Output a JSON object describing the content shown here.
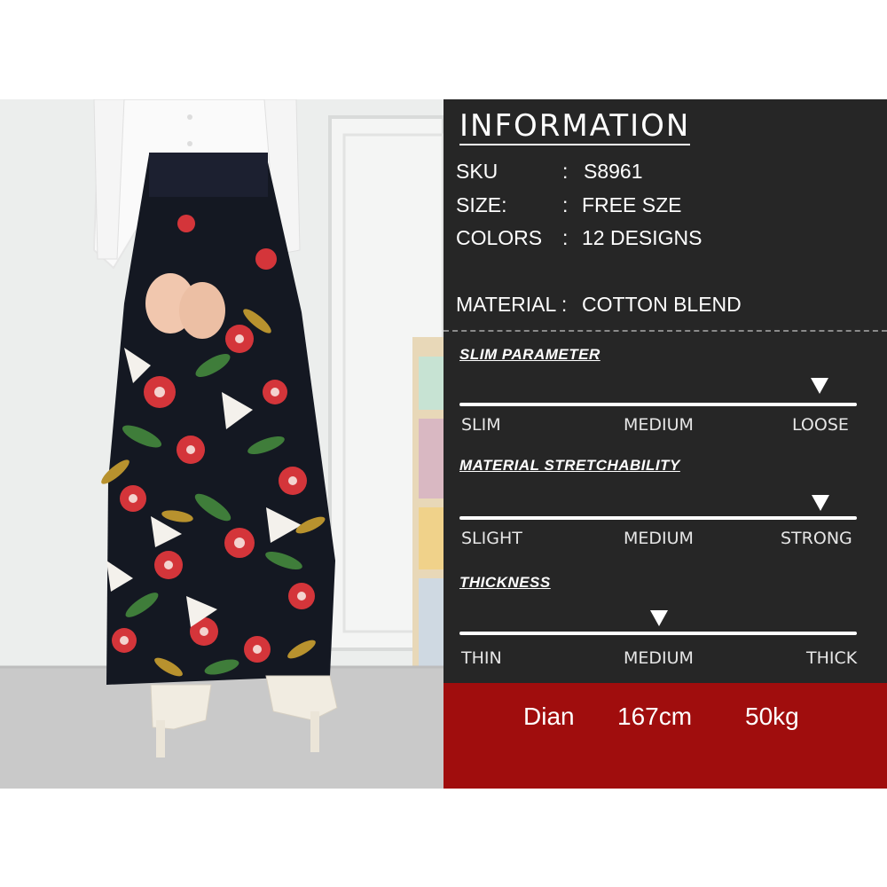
{
  "info": {
    "title": "INFORMATION",
    "rows": [
      {
        "key": "SKU",
        "sep": ":",
        "value": "S8961"
      },
      {
        "key": "SIZE:",
        "sep": ":",
        "value": "FREE SZE"
      },
      {
        "key": "COLORS",
        "sep": ":",
        "value": "12 DESIGNS"
      },
      {
        "key": "MATERIAL :",
        "sep": "",
        "value": "COTTON BLEND"
      }
    ]
  },
  "params": [
    {
      "label": "SLIM PARAMETER",
      "ticks": [
        "SLIM",
        "MEDIUM",
        "LOOSE"
      ],
      "selected": "LOOSE"
    },
    {
      "label": "MATERIAL STRETCHABILITY",
      "ticks": [
        "SLIGHT",
        "MEDIUM",
        "STRONG"
      ],
      "selected": "STRONG"
    },
    {
      "label": "THICKNESS",
      "ticks": [
        "THIN",
        "MEDIUM",
        "THICK"
      ],
      "selected": "MEDIUM"
    }
  ],
  "model": {
    "name": "Dian",
    "height": "167cm",
    "weight": "50kg"
  },
  "colors": {
    "panel": "#262626",
    "accent_bar": "#a00d0d",
    "text": "#ffffff"
  }
}
